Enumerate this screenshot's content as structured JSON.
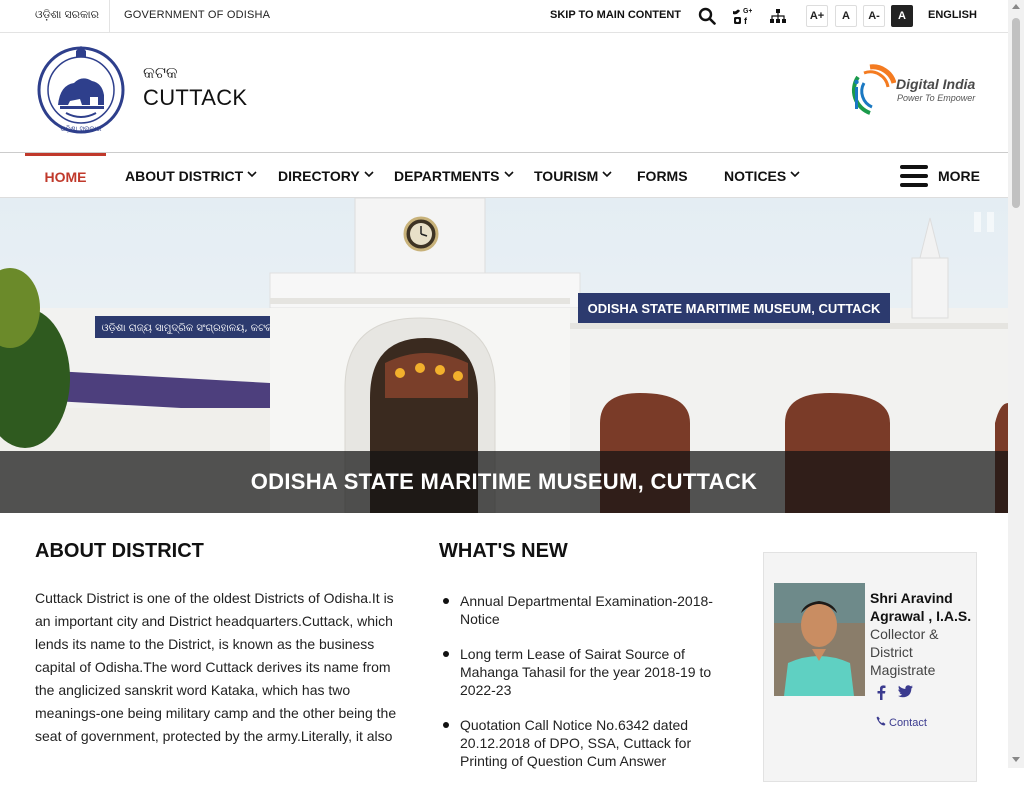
{
  "topbar": {
    "gov_odia": "ଓଡ଼ିଶା ସରକାର",
    "gov_english": "GOVERNMENT OF ODISHA",
    "skip_link": "SKIP TO MAIN CONTENT",
    "font_increase": "A+",
    "font_normal": "A",
    "font_decrease": "A-",
    "contrast": "A",
    "language": "ENGLISH",
    "icons": [
      "search-icon",
      "social-media-icon",
      "sitemap-icon"
    ]
  },
  "header": {
    "site_name_odia": "କଟକ",
    "site_name": "CUTTACK",
    "emblem_text": "ଓଡ଼ିଶା ସରକାର",
    "digital_india_title": "Digital India",
    "digital_india_tagline": "Power To Empower"
  },
  "nav": {
    "items": [
      {
        "label": "HOME",
        "active": true,
        "dropdown": false
      },
      {
        "label": "ABOUT DISTRICT",
        "active": false,
        "dropdown": true
      },
      {
        "label": "DIRECTORY",
        "active": false,
        "dropdown": true
      },
      {
        "label": "DEPARTMENTS",
        "active": false,
        "dropdown": true
      },
      {
        "label": "TOURISM",
        "active": false,
        "dropdown": true
      },
      {
        "label": "FORMS",
        "active": false,
        "dropdown": false
      },
      {
        "label": "NOTICES",
        "active": false,
        "dropdown": true
      }
    ],
    "more_label": "MORE"
  },
  "banner": {
    "caption": "ODISHA STATE MARITIME MUSEUM, CUTTACK",
    "sign_text": "ODISHA STATE MARITIME MUSEUM, CUTTACK",
    "sign_text_odia": "ଓଡ଼ିଶା ରାଜ୍ୟ ସାମୁଦ୍ରିକ ସଂଗ୍ରହାଳୟ, କଟକ"
  },
  "about": {
    "title": "ABOUT DISTRICT",
    "text": "Cuttack District is one of the oldest Districts of Odisha.It is an important city and District headquarters.Cuttack, which lends its name to the District, is known as the business capital of Odisha.The word Cuttack derives its name from the anglicized sanskrit word Kataka, which has two meanings-one being military camp and the other being the seat of government, protected by the army.Literally, it also"
  },
  "whats_new": {
    "title": "WHAT'S NEW",
    "items": [
      "Annual Departmental Examination-2018-Notice",
      "Long term Lease of Sairat Source of Mahanga Tahasil for the year 2018-19 to 2022-23",
      "Quotation Call Notice No.6342 dated 20.12.2018 of DPO, SSA, Cuttack for Printing of Question Cum Answer"
    ]
  },
  "officer": {
    "name": "Shri Aravind Agrawal , I.A.S.",
    "role": "Collector & District Magistrate",
    "contact_label": "Contact",
    "social_icons": [
      "facebook-icon",
      "twitter-icon"
    ]
  },
  "colors": {
    "accent_red": "#c0392b",
    "text_dark": "#111111",
    "caption_bg": "#141414"
  }
}
